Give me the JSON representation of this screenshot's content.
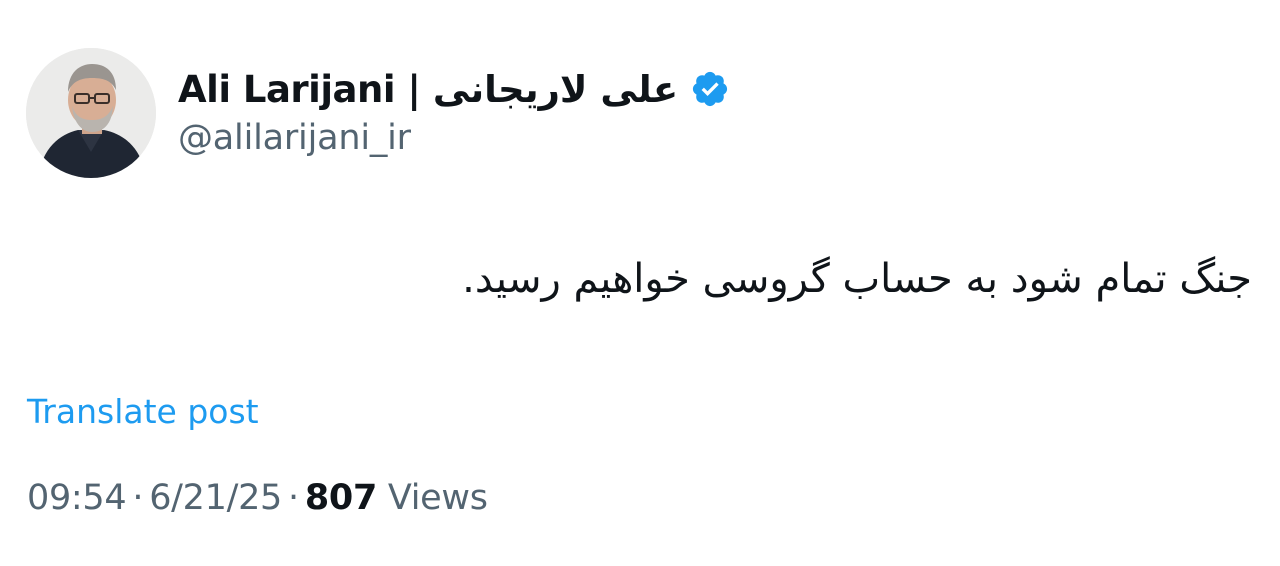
{
  "author": {
    "display_name": "Ali Larijani | علی لاریجانی",
    "handle": "@alilarijani_ir",
    "verified_icon": "verified-badge-icon",
    "badge_color": "#1d9bf0"
  },
  "post": {
    "text": "جنگ تمام شود به حساب گروسی خواهیم رسید.",
    "translate_label": "Translate post"
  },
  "meta": {
    "time": "09:54",
    "separator": "·",
    "date": "6/21/25",
    "views_count": "807",
    "views_label": "Views"
  },
  "colors": {
    "text_primary": "#0f1419",
    "text_secondary": "#536471",
    "link": "#1d9bf0"
  }
}
